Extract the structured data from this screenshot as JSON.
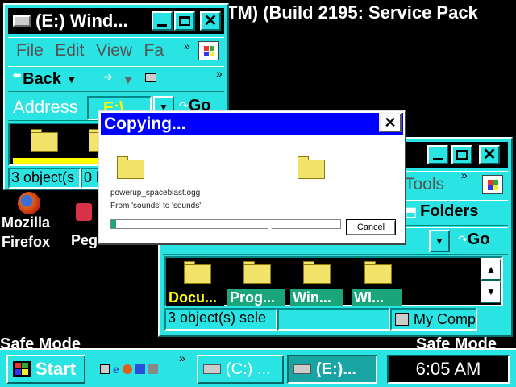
{
  "desktop": {
    "banner_text": "TM) (Build 2195: Service Pack",
    "banner_overlay": "Safe Mode",
    "safe_mode_left": "Safe Mode",
    "safe_mode_right": "Safe Mode",
    "icons": [
      {
        "name": "firefox",
        "label_line1": "Mozilla",
        "label_line2": "Firefox"
      },
      {
        "name": "pegasus",
        "label_line1": "Peg",
        "label_line2": ""
      }
    ]
  },
  "window_e": {
    "title": "(E:) Wind...",
    "menu": [
      "File",
      "Edit",
      "View",
      "Fa"
    ],
    "menu_more": "»",
    "back_label": "Back",
    "address_label": "Address",
    "address_value": "E:\\",
    "go_label": "Go",
    "status": "3 object(s",
    "status2": "0 b"
  },
  "window_c": {
    "menu_tools": "Tools",
    "folders_label": "Folders",
    "go_label": "Go",
    "files": [
      "Docu...",
      "Prog...",
      "Win...",
      "WI..."
    ],
    "status": "3 object(s) sele",
    "status_computer": "My Comp"
  },
  "dialog": {
    "title": "Copying...",
    "filename": "powerup_spaceblast.ogg",
    "from_to": "From 'sounds' to 'sounds'",
    "cancel_label": "Cancel",
    "progress": 0.02
  },
  "taskbar": {
    "start_label": "Start",
    "tasks": [
      {
        "label": "(C:) ...",
        "active": false
      },
      {
        "label": "(E:)...",
        "active": true
      }
    ],
    "clock": "6:05 AM",
    "more": "»"
  },
  "colors": {
    "window_face": "#2ae3e3",
    "dialog_title": "#0000ff",
    "file_label_bg": "#1aa57a",
    "selected_label": "#ffff00"
  }
}
